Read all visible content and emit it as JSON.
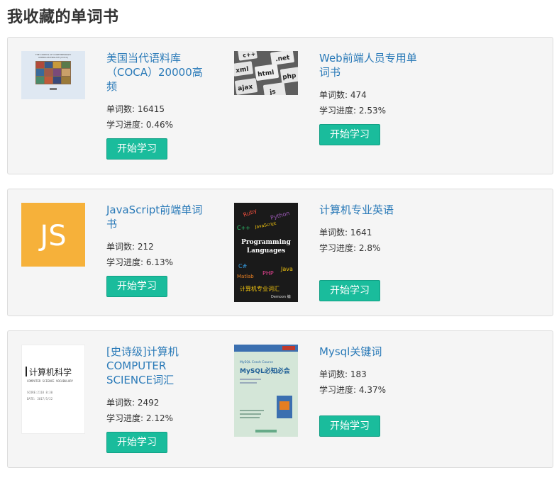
{
  "page_title": "我收藏的单词书",
  "labels": {
    "word_count": "单词数",
    "progress": "学习进度",
    "start_button": "开始学习"
  },
  "books": [
    {
      "title": "美国当代语料库（COCA）20000高频",
      "word_count": "16415",
      "progress": "0.46%",
      "cover_icon": "coca-book-cover",
      "cover_text": "THE CORPUS OF CONTEMPORARY AMERICAN ENGLISH (COCA)"
    },
    {
      "title": "Web前端人员专用单词书",
      "word_count": "474",
      "progress": "2.53%",
      "cover_icon": "keyboard-keys-cover",
      "cover_keys": [
        "c++",
        ".net",
        "xml",
        "html",
        "php",
        "ajax",
        "js"
      ]
    },
    {
      "title": "JavaScript前端单词书",
      "word_count": "212",
      "progress": "6.13%",
      "cover_icon": "js-logo-cover",
      "cover_text": "JS"
    },
    {
      "title": "计算机专业英语",
      "word_count": "1641",
      "progress": "2.8%",
      "cover_icon": "programming-languages-cover",
      "cover_text": "Programming Languages",
      "cover_words": [
        "Ruby",
        "Python",
        "C++",
        "JavaScript",
        "C#",
        "Matlab",
        "PHP",
        "Java"
      ],
      "cover_subtitle": "计算机专业词汇",
      "cover_author": "Demoon 编"
    },
    {
      "title": "[史诗级]计算机COMPUTER SCIENCE词汇",
      "word_count": "2492",
      "progress": "2.12%",
      "cover_icon": "computer-science-cover",
      "cover_title": "计算机科学",
      "cover_sub": "COMPUTER SCIENCE VOCABULARY",
      "cover_score": "SCORE:2118 8:30",
      "cover_date": "DATE: 2017/5/22"
    },
    {
      "title": "Mysql关键词",
      "word_count": "183",
      "progress": "4.37%",
      "cover_icon": "mysql-book-cover",
      "cover_text": "MySQL必知必会",
      "cover_small": "MySQL Crash Course"
    }
  ],
  "colors": {
    "accent_button": "#1abc9c",
    "link": "#2a7ab8",
    "panel_bg": "#f5f5f5",
    "js_yellow": "#f6b13a"
  }
}
